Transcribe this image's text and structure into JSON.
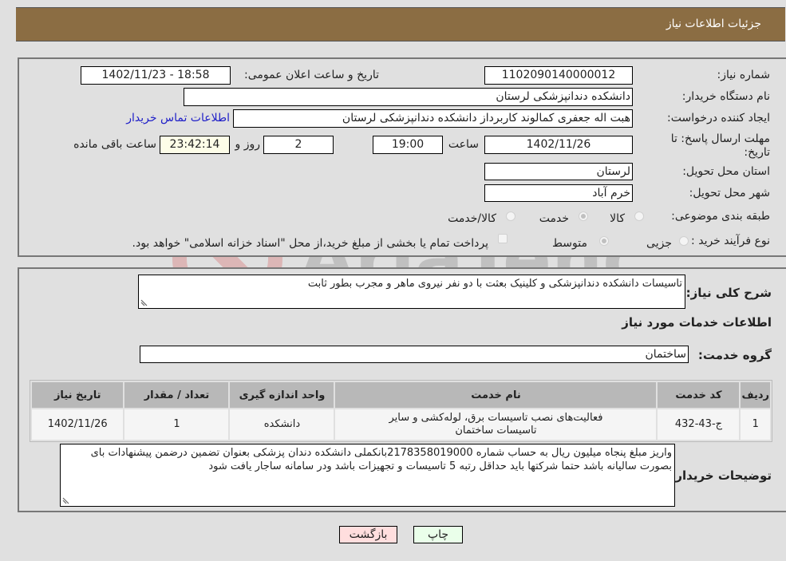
{
  "header": {
    "title": "جزئیات اطلاعات نیاز"
  },
  "form": {
    "need_number": {
      "label": "شماره نیاز:",
      "value": "1102090140000012"
    },
    "announce_datetime": {
      "label": "تاریخ و ساعت اعلان عمومی:",
      "value": "1402/11/23 - 18:58"
    },
    "buyer_org": {
      "label": "نام دستگاه خریدار:",
      "value": "دانشکده دندانپزشکی لرستان"
    },
    "requester": {
      "label": "ایجاد کننده درخواست:",
      "value": "هبت اله جعفری کمالوند کاربرداز دانشکده دندانپزشکی لرستان"
    },
    "contact_link": "اطلاعات تماس خریدار",
    "deadline": {
      "label_line1": "مهلت ارسال پاسخ: تا",
      "label_line2": "تاریخ:",
      "date": "1402/11/26",
      "time_label": "ساعت",
      "time": "19:00",
      "days": "2",
      "days_label": "روز و",
      "remaining": "23:42:14",
      "remaining_label": "ساعت باقی مانده"
    },
    "province": {
      "label": "استان محل تحویل:",
      "value": "لرستان"
    },
    "city": {
      "label": "شهر محل تحویل:",
      "value": "خرم آباد"
    },
    "category": {
      "label": "طبقه بندی موضوعی:",
      "options": [
        "کالا",
        "خدمت",
        "کالا/خدمت"
      ],
      "selected": "خدمت"
    },
    "purchase_type": {
      "label": "نوع فرآیند خرید :",
      "options": [
        "جزیی",
        "متوسط"
      ],
      "selected": "متوسط",
      "treasury_note": "پرداخت تمام یا بخشی از مبلغ خرید،از محل \"اسناد خزانه اسلامی\" خواهد بود."
    }
  },
  "description": {
    "label": "شرح کلی نیاز:",
    "value": "تاسیسات دانشکده دندانپزشکی و کلینیک بعثت با دو نفر نیروی ماهر و مجرب بطور ثابت"
  },
  "services": {
    "section_title": "اطلاعات خدمات مورد نیاز",
    "group_label": "گروه خدمت:",
    "group_value": "ساختمان",
    "table": {
      "headers": [
        "ردیف",
        "کد خدمت",
        "نام خدمت",
        "واحد اندازه گیری",
        "تعداد / مقدار",
        "تاریخ نیاز"
      ],
      "rows": [
        [
          "1",
          "ج-43-432",
          "فعالیت‌های نصب تاسیسات برق، لوله‌کشی و سایر تاسیسات ساختمان",
          "دانشکده",
          "1",
          "1402/11/26"
        ]
      ]
    }
  },
  "buyer_notes": {
    "label": "توضیحات خریدار:",
    "value": "واریز مبلغ پنجاه میلیون ریال به حساب شماره 2178358019000بانکملی دانشکده دندان پزشکی بعنوان تضمین درضمن پیشنهادات بای بصورت سالیانه باشد حتما شرکتها باید حداقل رتبه 5 تاسیسات و تجهیزات باشد ودر سامانه ساجار یافت شود"
  },
  "buttons": {
    "print": "چاپ",
    "back": "بازگشت"
  },
  "watermark": "AriaTender.neT",
  "colors": {
    "header_bg": "#8b6d43",
    "link": "#2020c8",
    "print_bg": "#eaffea",
    "back_bg": "#ffdede"
  }
}
